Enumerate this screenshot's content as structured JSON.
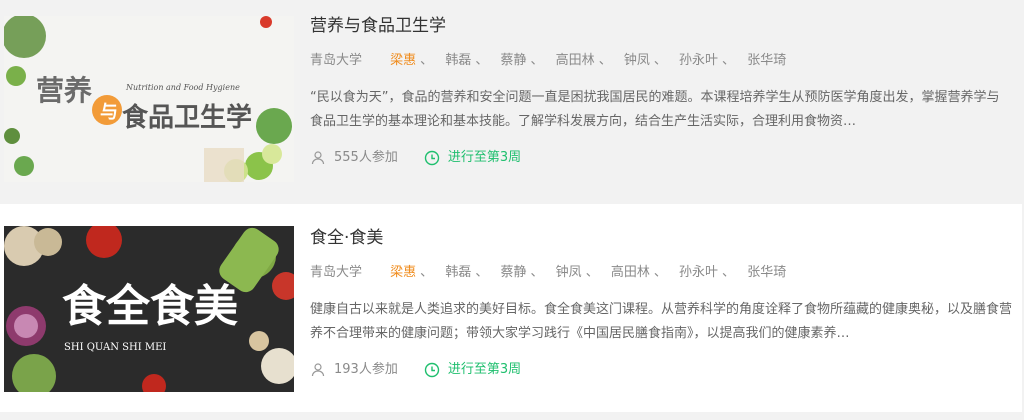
{
  "courses": [
    {
      "title": "营养与食品卫生学",
      "thumb_title_cn_1": "营养",
      "thumb_title_cn_2": "食品卫生学",
      "thumb_connector": "与",
      "thumb_subtitle_en": "Nutrition and Food Hygiene",
      "school": "青岛大学",
      "teachers": [
        "梁惠",
        "韩磊",
        "蔡静",
        "高田林",
        "钟凤",
        "孙永叶",
        "张华琦"
      ],
      "description": "“民以食为天”，食品的营养和安全问题一直是困扰我国居民的难题。本课程培养学生从预防医学角度出发，掌握营养学与食品卫生学的基本理论和基本技能。了解学科发展方向，结合生产生活实际，合理利用食物资…",
      "participants": "555人参加",
      "progress": "进行至第3周"
    },
    {
      "title": "食全·食美",
      "thumb_title_cn": "食全食美",
      "thumb_subtitle_en": "SHI QUAN SHI MEI",
      "school": "青岛大学",
      "teachers": [
        "梁惠",
        "韩磊",
        "蔡静",
        "钟凤",
        "高田林",
        "孙永叶",
        "张华琦"
      ],
      "description": "健康自古以来就是人类追求的美好目标。食全食美这门课程。从营养科学的角度诠释了食物所蕴藏的健康奥秘，以及膳食营养不合理带来的健康问题；带领大家学习践行《中国居民膳食指南》，以提高我们的健康素养…",
      "participants": "193人参加",
      "progress": "进行至第3周"
    }
  ],
  "icons": {
    "participants": "user-icon",
    "progress": "clock-icon"
  },
  "colors": {
    "highlight_teacher": "#f08c1d",
    "progress": "#1fbf6e",
    "muted": "#8a8a8a"
  }
}
